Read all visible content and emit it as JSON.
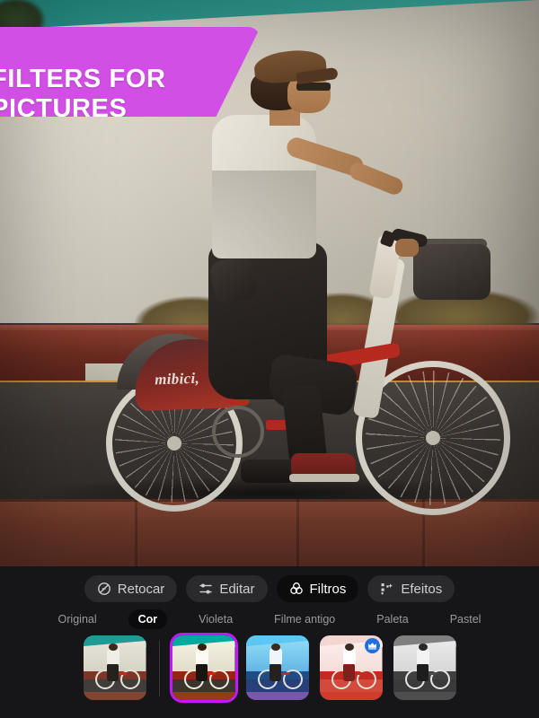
{
  "banner": {
    "line1": "FILTERS FOR",
    "line2": "PICTURES",
    "color": "#d24fe6"
  },
  "photo": {
    "description": "Person riding a red mibici bicycle along a street",
    "bike_brand": "mibici,"
  },
  "toolbar": {
    "items": [
      {
        "label": "Retocar",
        "icon": "retouch-icon",
        "active": false
      },
      {
        "label": "Editar",
        "icon": "sliders-icon",
        "active": false
      },
      {
        "label": "Filtros",
        "icon": "filters-icon",
        "active": true
      },
      {
        "label": "Efeitos",
        "icon": "effects-icon",
        "active": false
      }
    ]
  },
  "categories": {
    "items": [
      {
        "label": "Original",
        "active": false
      },
      {
        "label": "Cor",
        "active": true
      },
      {
        "label": "Violeta",
        "active": false
      },
      {
        "label": "Filme antigo",
        "active": false
      },
      {
        "label": "Paleta",
        "active": false
      },
      {
        "label": "Pastel",
        "active": false
      }
    ]
  },
  "filter_thumbnails": {
    "items": [
      {
        "name": "original",
        "selected": false,
        "premium": false,
        "style": "f-orig"
      },
      {
        "name": "cor-1",
        "selected": true,
        "premium": false,
        "style": "f-cor"
      },
      {
        "name": "cor-2",
        "selected": false,
        "premium": false,
        "style": "f-viol"
      },
      {
        "name": "cor-3",
        "selected": false,
        "premium": true,
        "style": "f-red"
      },
      {
        "name": "cor-4",
        "selected": false,
        "premium": false,
        "style": "f-gray"
      }
    ],
    "selected_border_color": "#a22fd0",
    "premium_badge_color": "#1f6fe0"
  }
}
